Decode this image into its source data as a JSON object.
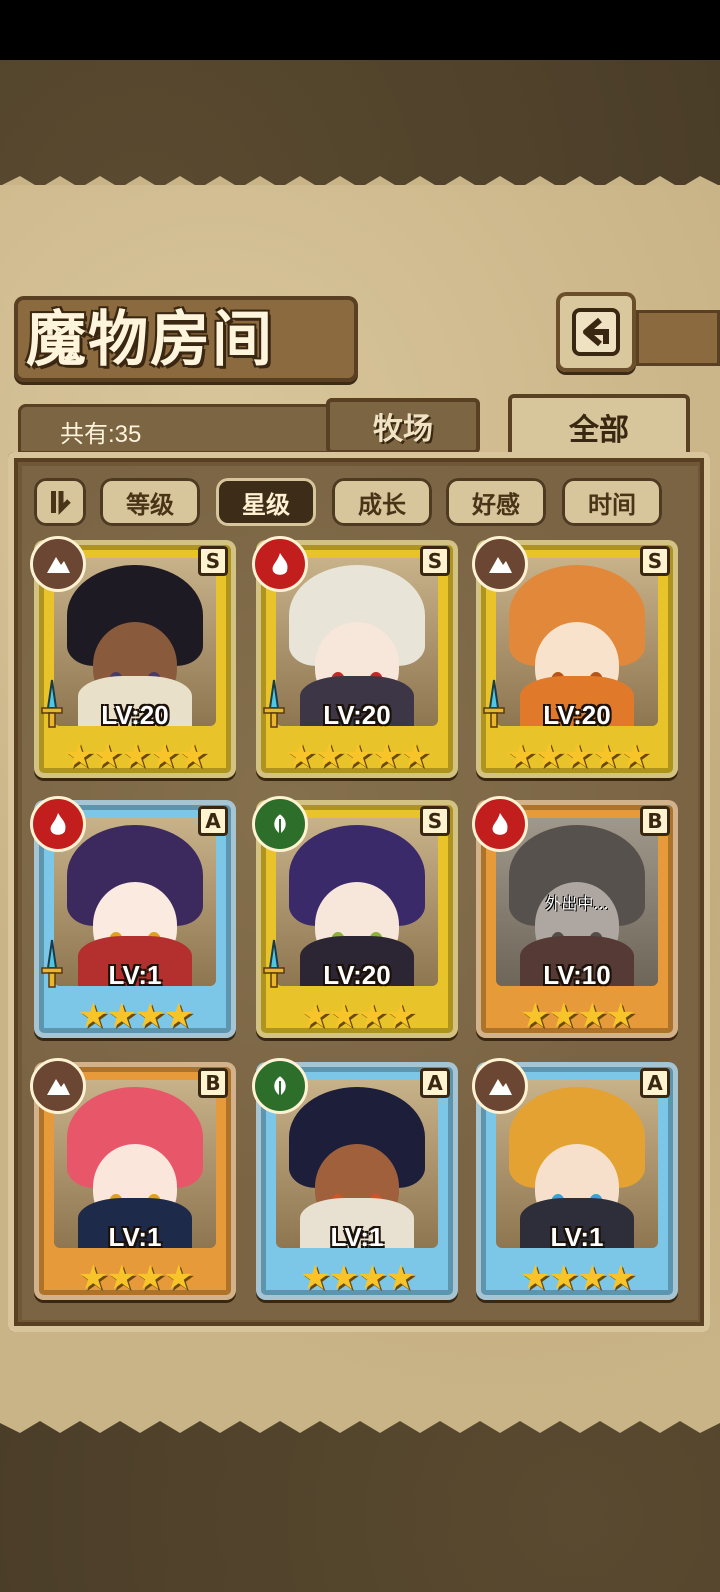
{
  "title": "魔物房间",
  "total_count": "共有:35",
  "tabs": [
    {
      "label": "牧场",
      "active": false
    },
    {
      "label": "全部",
      "active": true
    }
  ],
  "sort_buttons": [
    {
      "label": "等级",
      "active": false
    },
    {
      "label": "星级",
      "active": true
    },
    {
      "label": "成长",
      "active": false
    },
    {
      "label": "好感",
      "active": false
    },
    {
      "label": "时间",
      "active": false
    }
  ],
  "monsters": [
    {
      "level": "LV:20",
      "rank": "S",
      "element": "earth-icon",
      "stars": "★★★★★",
      "frame": "gold",
      "has_sword": true,
      "hair": "#1e1a24",
      "skin": "#8a5a3c",
      "eyes": "#4a3a66",
      "outfit": "#e8e0c8"
    },
    {
      "level": "LV:20",
      "rank": "S",
      "element": "fire-icon",
      "stars": "★★★★★",
      "frame": "gold",
      "has_sword": true,
      "hair": "#e8e4d8",
      "skin": "#f7e6da",
      "eyes": "#c22a2a",
      "outfit": "#3c3646"
    },
    {
      "level": "LV:20",
      "rank": "S",
      "element": "earth-icon",
      "stars": "★★★★★",
      "frame": "gold",
      "has_sword": true,
      "hair": "#e2883a",
      "skin": "#f8e2cc",
      "eyes": "#b6551a",
      "outfit": "#e07a2a"
    },
    {
      "level": "LV:1",
      "rank": "A",
      "element": "fire-icon",
      "stars": "★★★★",
      "frame": "blue",
      "has_sword": true,
      "hair": "#3c2a5e",
      "skin": "#fbeadf",
      "eyes": "#e0a21c",
      "outfit": "#b3302e"
    },
    {
      "level": "LV:20",
      "rank": "S",
      "element": "leaf-icon",
      "stars": "★★★★",
      "frame": "gold",
      "has_sword": true,
      "hair": "#3a2a6a",
      "skin": "#f7e6da",
      "eyes": "#8cb23a",
      "outfit": "#2c2634"
    },
    {
      "level": "LV:10",
      "rank": "B",
      "element": "fire-icon",
      "stars": "★★★★",
      "frame": "orange",
      "has_sword": false,
      "status": "外出中...",
      "hair": "#6c5e52",
      "skin": "#d8c3b0",
      "eyes": "#6a5a4a",
      "outfit": "#8a3a2e"
    },
    {
      "level": "LV:1",
      "rank": "B",
      "element": "earth-icon",
      "stars": "★★★★",
      "frame": "orange",
      "has_sword": false,
      "hair": "#e8566a",
      "skin": "#fbe6dc",
      "eyes": "#e0a21c",
      "outfit": "#1e2a4a"
    },
    {
      "level": "LV:1",
      "rank": "A",
      "element": "leaf-icon",
      "stars": "★★★★",
      "frame": "blue",
      "has_sword": false,
      "hair": "#1c1e3a",
      "skin": "#a0603c",
      "eyes": "#d0542a",
      "outfit": "#e8e0d0"
    },
    {
      "level": "LV:1",
      "rank": "A",
      "element": "earth-icon",
      "stars": "★★★★",
      "frame": "blue",
      "has_sword": false,
      "hair": "#e4a232",
      "skin": "#f6e0cc",
      "eyes": "#3aa0d8",
      "outfit": "#2e2e3a"
    }
  ],
  "colors": {
    "frame_gold": "#e8c42a",
    "frame_blue": "#7cc6e8",
    "frame_orange": "#e79a3a",
    "element_fire": "#c21e1e",
    "element_leaf": "#2d6e2a",
    "element_earth": "#6b4632"
  }
}
